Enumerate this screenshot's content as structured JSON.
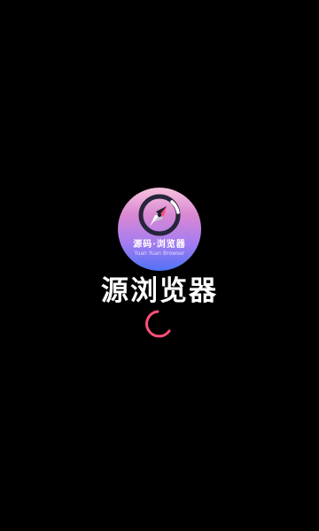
{
  "screen": {
    "background_color": "#000000"
  },
  "logo": {
    "icon": "compass-icon",
    "main_text": "源码·浏览器",
    "sub_text": "Yuan Yuan Browser",
    "gradient_colors": [
      "#f7c2de",
      "#d988d2",
      "#a57cf0",
      "#4f73f6"
    ]
  },
  "app": {
    "name": "源浏览器"
  },
  "loading": {
    "icon": "loading-spinner-icon",
    "color": "#ff4f78"
  }
}
